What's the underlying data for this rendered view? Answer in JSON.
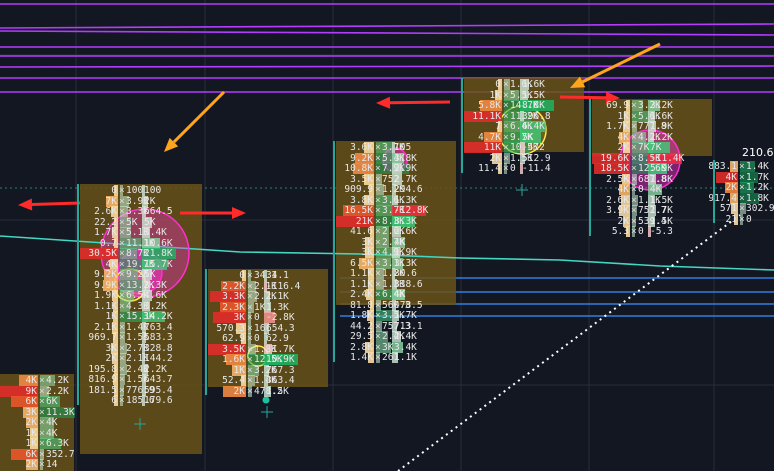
{
  "price_label": "210.6",
  "colors": {
    "background": "#131722",
    "grid": "#2a2e39",
    "purple_level": "#b43cff",
    "cyan_line": "#44d7c4",
    "blue_level": "#2f7fe0",
    "dotted_line": "#ffffff",
    "arrow_red": "#ff2a2a",
    "arrow_orange": "#ffa41c",
    "value_area": "#6a5218",
    "poc": "#e8312c",
    "ask": "#2ecc71",
    "bid": "#f49a3a",
    "marker_pink": "#ff2fd0",
    "marker_yellow": "#ffe84a"
  },
  "clusters": [
    {
      "name": "cluster-1",
      "rows": [
        {
          "bid": "4K",
          "ask": "4.2K"
        },
        {
          "bid": "9K",
          "ask": "2.2K"
        },
        {
          "bid": "6K",
          "ask": "6K"
        },
        {
          "bid": "3K",
          "ask": "11.3K"
        },
        {
          "bid": "2K",
          "ask": "4K"
        },
        {
          "bid": "1K",
          "ask": "4K"
        },
        {
          "bid": "1K",
          "ask": "6.3K"
        },
        {
          "bid": "6K",
          "ask": "352.7"
        },
        {
          "bid": "2K",
          "ask": "14"
        }
      ]
    },
    {
      "name": "cluster-2",
      "rows": [
        {
          "bid": "0",
          "ask": "100",
          "delta": "100"
        },
        {
          "bid": "7K",
          "ask": "3.9K",
          "delta": "2K"
        },
        {
          "bid": "2.6K",
          "ask": "3.3K",
          "delta": "664.5"
        },
        {
          "bid": "22.2",
          "ask": "5K",
          "delta": "5K"
        },
        {
          "bid": "1.7K",
          "ask": "5.1K",
          "delta": "3.4K"
        },
        {
          "bid": "0.7",
          "ask": "11.1K",
          "delta": "10.6K"
        },
        {
          "bid": "30.5K",
          "ask": "8.7K",
          "delta": "21.8K"
        },
        {
          "bid": "4K",
          "ask": "19.7K",
          "delta": "15.7K"
        },
        {
          "bid": "9.2K",
          "ask": "9.2K",
          "delta": "5K"
        },
        {
          "bid": "9.9K",
          "ask": "13.2K",
          "delta": "3.3K"
        },
        {
          "bid": "1.9K",
          "ask": "6.5K",
          "delta": "4.6K"
        },
        {
          "bid": "1.1K",
          "ask": "4.3K",
          "delta": "3.2K"
        },
        {
          "bid": "1K",
          "ask": "15.3K",
          "delta": "14.2K"
        },
        {
          "bid": "2.1K",
          "ask": "1.4K",
          "delta": "763.4"
        },
        {
          "bid": "969.7",
          "ask": "1.5K",
          "delta": "583.3"
        },
        {
          "bid": "3K",
          "ask": "2.7K",
          "delta": "328.8"
        },
        {
          "bid": "2K",
          "ask": "2.1K",
          "delta": "144.2"
        },
        {
          "bid": "195.8",
          "ask": "2.4K",
          "delta": "2.2K"
        },
        {
          "bid": "816.9",
          "ask": "1.5K",
          "delta": "643.7"
        },
        {
          "bid": "181.5",
          "ask": "776.9",
          "delta": "595.4"
        },
        {
          "bid": "6",
          "ask": "185.6",
          "delta": "179.6"
        }
      ]
    },
    {
      "name": "cluster-3",
      "rows": [
        {
          "bid": "0",
          "ask": "34.1",
          "delta": "34.1"
        },
        {
          "bid": "2.2K",
          "ask": "2.1K",
          "delta": "-116.4"
        },
        {
          "bid": "3.3K",
          "ask": "2.2K",
          "delta": "1.1K"
        },
        {
          "bid": "2.3K",
          "ask": "1K",
          "delta": "1.3K"
        },
        {
          "bid": "3K",
          "ask": "0",
          "delta": "-2.8K"
        },
        {
          "bid": "570.3",
          "ask": "16",
          "delta": "654.3"
        },
        {
          "bid": "62.9",
          "ask": "0",
          "delta": "62.9"
        },
        {
          "bid": "3.5K",
          "ask": "1.8K",
          "delta": "-1.7K"
        },
        {
          "bid": "1.6K",
          "ask": "12.5K",
          "delta": "10.9K"
        },
        {
          "bid": "1K",
          "ask": "3.2K",
          "delta": "767.3"
        },
        {
          "bid": "52.4",
          "ask": "1.4K",
          "delta": "363.4"
        },
        {
          "bid": "2K",
          "ask": "478.2",
          "delta": "1.5K"
        }
      ]
    },
    {
      "name": "cluster-4",
      "rows": [
        {
          "bid": "3.6K",
          "ask": "3.7K",
          "delta": "105"
        },
        {
          "bid": "9.2K",
          "ask": "5.4K",
          "delta": "3.8K"
        },
        {
          "bid": "10.8K",
          "ask": "7.9K",
          "delta": "2.9K"
        },
        {
          "bid": "3.5K",
          "ask": "752",
          "delta": "2.7K"
        },
        {
          "bid": "909.9",
          "ask": "1.2K",
          "delta": "294.6"
        },
        {
          "bid": "3.8K",
          "ask": "3.6K",
          "delta": "1.3K"
        },
        {
          "bid": "16.5K",
          "ask": "3.7K",
          "delta": "-12.8K"
        },
        {
          "bid": "21K",
          "ask": "8.3K",
          "delta": "8.3K"
        },
        {
          "bid": "41.6",
          "ask": "2.6K",
          "delta": "2.6K"
        },
        {
          "bid": "3K",
          "ask": "2.7K",
          "delta": "4K"
        },
        {
          "bid": "3K",
          "ask": "4.9K",
          "delta": "1.9K"
        },
        {
          "bid": "6.5K",
          "ask": "3.1K",
          "delta": "3.3K"
        },
        {
          "bid": "1.1K",
          "ask": "1.2K",
          "delta": "80.6"
        },
        {
          "bid": "1.1K",
          "ask": "1.3K",
          "delta": "838.6"
        },
        {
          "bid": "2.4K",
          "ask": "6.4K",
          "delta": "4K"
        },
        {
          "bid": "81.8",
          "ask": "560.3",
          "delta": "478.5"
        },
        {
          "bid": "1.8K",
          "ask": "3.5K",
          "delta": "1.7K"
        },
        {
          "bid": "44.2",
          "ask": "757.3",
          "delta": "713.1"
        },
        {
          "bid": "29.5",
          "ask": "2.4K",
          "delta": "2.4K"
        },
        {
          "bid": "2.8K",
          "ask": "3K",
          "delta": "3.4K"
        },
        {
          "bid": "1.4K",
          "ask": "261",
          "delta": "1.1K"
        }
      ]
    },
    {
      "name": "cluster-5",
      "rows": [
        {
          "bid": "0",
          "ask": "1.6K",
          "delta": "1.6K"
        },
        {
          "bid": "1K",
          "ask": "5.5K",
          "delta": "1.5K"
        },
        {
          "bid": "5.8K",
          "ask": "14.7K",
          "delta": "8.8K"
        },
        {
          "bid": "11.1K",
          "ask": "11.2K",
          "delta": "396.8"
        },
        {
          "bid": "7",
          "ask": "6.4K",
          "delta": "6.4K"
        },
        {
          "bid": "4.7K",
          "ask": "9.7K",
          "delta": "5K"
        },
        {
          "bid": "11K",
          "ask": "10.5K",
          "delta": "-472"
        },
        {
          "bid": "2K",
          "ask": "1.5K",
          "delta": "512.9"
        },
        {
          "bid": "11.4",
          "ask": "0",
          "delta": "-11.4"
        }
      ]
    },
    {
      "name": "cluster-6",
      "rows": [
        {
          "bid": "69.9",
          "ask": "3.2K",
          "delta": "3.2K"
        },
        {
          "bid": "1K",
          "ask": "5.6K",
          "delta": "1.6K"
        },
        {
          "bid": "1.7K",
          "ask": "777.8",
          "delta": "1.9K"
        },
        {
          "bid": "4K",
          "ask": "4.2K",
          "delta": "1.2K"
        },
        {
          "bid": "2K",
          "ask": "7K",
          "delta": "7K"
        },
        {
          "bid": "19.6K",
          "ask": "8.5K",
          "delta": "-11.4K"
        },
        {
          "bid": "18.5K",
          "ask": "12.6K",
          "delta": "5.9K"
        },
        {
          "bid": "2.5K",
          "ask": "687.8",
          "delta": "1.8K"
        },
        {
          "bid": "4K",
          "ask": "0",
          "delta": "4K"
        },
        {
          "bid": "2.6K",
          "ask": "1.1K",
          "delta": "1.5K"
        },
        {
          "bid": "3.9K",
          "ask": "752.7",
          "delta": "1.7K"
        },
        {
          "bid": "2K",
          "ask": "539.4",
          "delta": "1.5K"
        },
        {
          "bid": "5.3",
          "ask": "0",
          "delta": "-5.3"
        }
      ]
    },
    {
      "name": "cluster-7",
      "rows": [
        {
          "bid": "883.1",
          "ask": "1.4K",
          "delta": ""
        },
        {
          "bid": "4K",
          "ask": "1.7K",
          "delta": ""
        },
        {
          "bid": "2K",
          "ask": "1.2K",
          "delta": ""
        },
        {
          "bid": "917.4",
          "ask": "1.8K",
          "delta": ""
        },
        {
          "bid": "571",
          "ask": "302.9",
          "delta": ""
        },
        {
          "bid": "21",
          "ask": "0",
          "delta": ""
        }
      ]
    }
  ]
}
